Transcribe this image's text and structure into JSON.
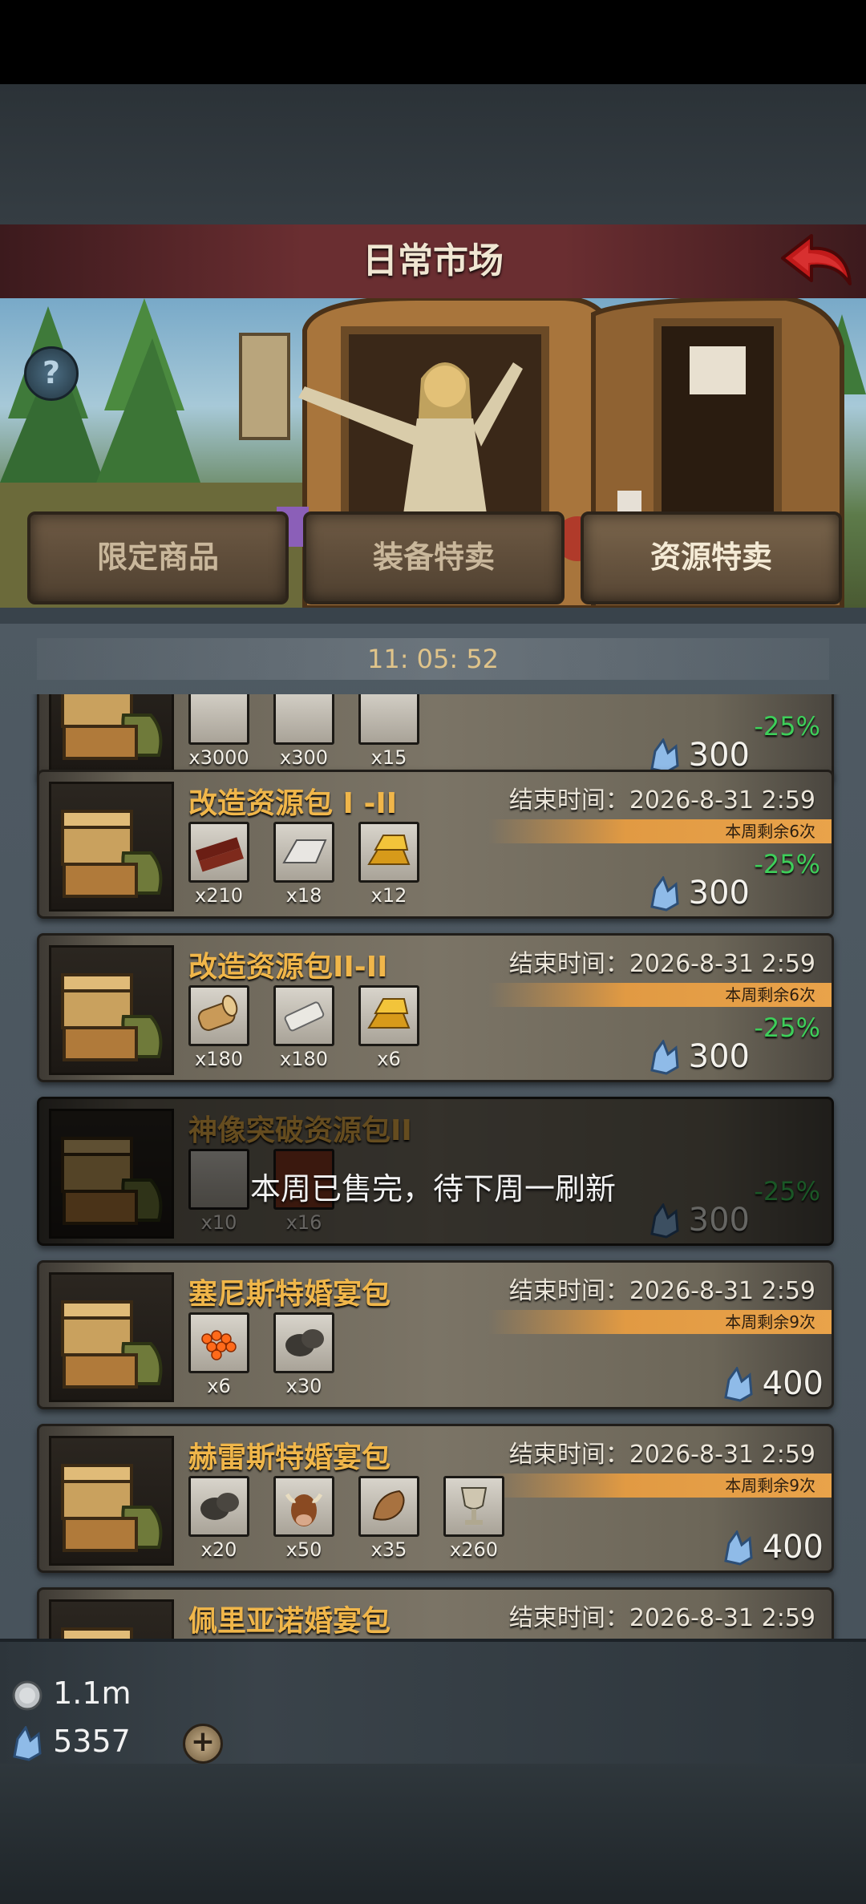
{
  "header": {
    "title": "日常市场"
  },
  "tabs": [
    {
      "label": "限定商品"
    },
    {
      "label": "装备特卖"
    },
    {
      "label": "资源特卖"
    }
  ],
  "timer": "11: 05: 52",
  "packs": [
    {
      "name": "",
      "end_time": "",
      "remaining": "",
      "items": [
        {
          "qty": "x3000"
        },
        {
          "qty": "x300"
        },
        {
          "qty": "x15"
        }
      ],
      "discount": "-25%",
      "price": "300"
    },
    {
      "name": "改造资源包 I -II",
      "end_time": "结束时间：2026-8-31 2:59",
      "remaining": "本周剩余6次",
      "items": [
        {
          "qty": "x210"
        },
        {
          "qty": "x18"
        },
        {
          "qty": "x12"
        }
      ],
      "discount": "-25%",
      "price": "300"
    },
    {
      "name": "改造资源包II-II",
      "end_time": "结束时间：2026-8-31 2:59",
      "remaining": "本周剩余6次",
      "items": [
        {
          "qty": "x180"
        },
        {
          "qty": "x180"
        },
        {
          "qty": "x6"
        }
      ],
      "discount": "-25%",
      "price": "300"
    },
    {
      "name": "神像突破资源包II",
      "end_time": "",
      "remaining": "",
      "items": [
        {
          "qty": "x10"
        },
        {
          "qty": "x16"
        }
      ],
      "discount": "-25%",
      "price": "300",
      "soldout_text": "本周已售完，待下周一刷新"
    },
    {
      "name": "塞尼斯特婚宴包",
      "end_time": "结束时间：2026-8-31 2:59",
      "remaining": "本周剩余9次",
      "items": [
        {
          "qty": "x6"
        },
        {
          "qty": "x30"
        }
      ],
      "discount": "",
      "price": "400"
    },
    {
      "name": "赫雷斯特婚宴包",
      "end_time": "结束时间：2026-8-31 2:59",
      "remaining": "本周剩余9次",
      "items": [
        {
          "qty": "x20"
        },
        {
          "qty": "x50"
        },
        {
          "qty": "x35"
        },
        {
          "qty": "x260"
        }
      ],
      "discount": "",
      "price": "400"
    },
    {
      "name": "佩里亚诺婚宴包",
      "end_time": "结束时间：2026-8-31 2:59",
      "remaining": "",
      "items": [],
      "discount": "",
      "price": ""
    }
  ],
  "currency": {
    "silver": "1.1m",
    "gems": "5357"
  },
  "icons": {
    "back": "red-back-arrow-icon",
    "help": "question-mark-icon",
    "gem": "blue-crystal-icon",
    "coin": "silver-coin-icon",
    "plus": "plus-icon"
  },
  "colors": {
    "header": "#6a2e31",
    "name_gold": "#f0b64a",
    "discount_green": "#3ecf5a",
    "remain_orange": "#e19a43"
  }
}
